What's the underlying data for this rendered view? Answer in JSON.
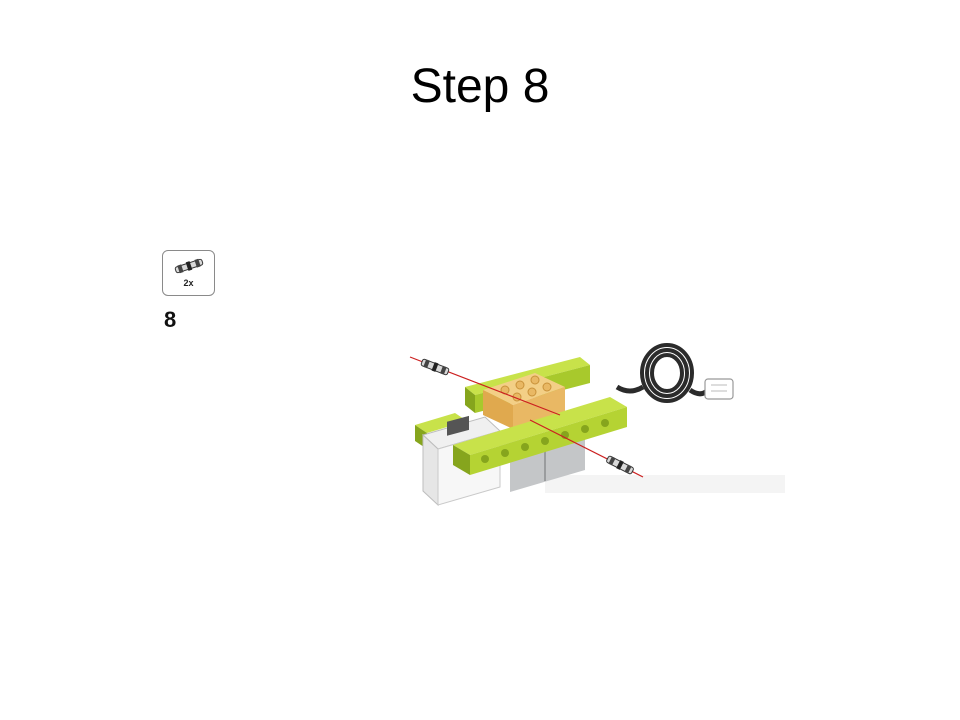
{
  "slide": {
    "title": "Step 8"
  },
  "instruction": {
    "step_number": "8",
    "parts": [
      {
        "icon": "connector-peg-icon",
        "quantity": "2x"
      }
    ]
  },
  "illustration": {
    "description_icon": "lego-build-assembly-icon",
    "colors": {
      "lime_beam": "#b5d333",
      "lime_dark": "#86a51d",
      "tan_brick": "#e9b864",
      "motor_grey": "#c4c6c8",
      "cable_black": "#2b2b2b",
      "axis_red": "#cc2020"
    }
  }
}
